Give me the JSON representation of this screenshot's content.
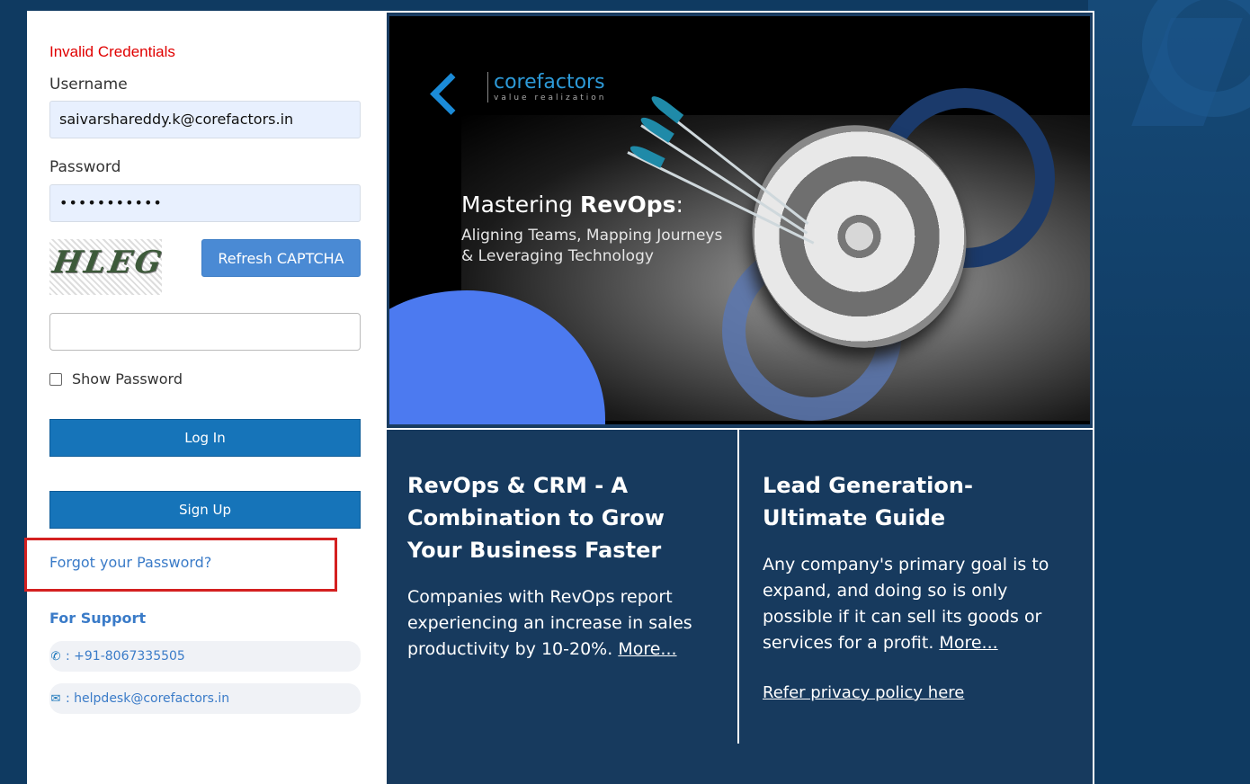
{
  "login": {
    "error": "Invalid Credentials",
    "username_label": "Username",
    "username_value": "saivarshareddy.k@corefactors.in",
    "password_label": "Password",
    "password_value": "•••••••••••",
    "captcha_text": "HLEG",
    "refresh_label": "Refresh CAPTCHA",
    "show_password_label": "Show Password",
    "login_label": "Log In",
    "signup_label": "Sign Up",
    "forgot_label": "Forgot your Password?"
  },
  "support": {
    "title": "For Support",
    "phone": ": +91-8067335505",
    "email": ": helpdesk@corefactors.in",
    "phone_icon": "phone-icon",
    "email_icon": "envelope-icon"
  },
  "banner": {
    "logo_name": "corefactors",
    "logo_tagline": "value realization",
    "title_prefix": "Mastering ",
    "title_bold": "RevOps",
    "title_suffix": ":",
    "subtitle_line1": "Aligning Teams, Mapping Journeys",
    "subtitle_line2": "& Leveraging Technology"
  },
  "cards": [
    {
      "title": "RevOps & CRM - A Combination to Grow Your Business Faster",
      "body": "Companies with RevOps report experiencing an increase in sales productivity by 10-20%. ",
      "more": "More..."
    },
    {
      "title": "Lead Generation- Ultimate Guide",
      "body": "Any company's primary goal is to expand, and doing so is only possible if it can sell its goods or services for a profit. ",
      "more": "More..."
    }
  ],
  "privacy_link": "Refer privacy policy here",
  "colors": {
    "error": "#e00000",
    "primary_button": "#1674b9",
    "link": "#3a7bc8",
    "background": "#0f3a61",
    "highlight_border": "#d42020"
  }
}
